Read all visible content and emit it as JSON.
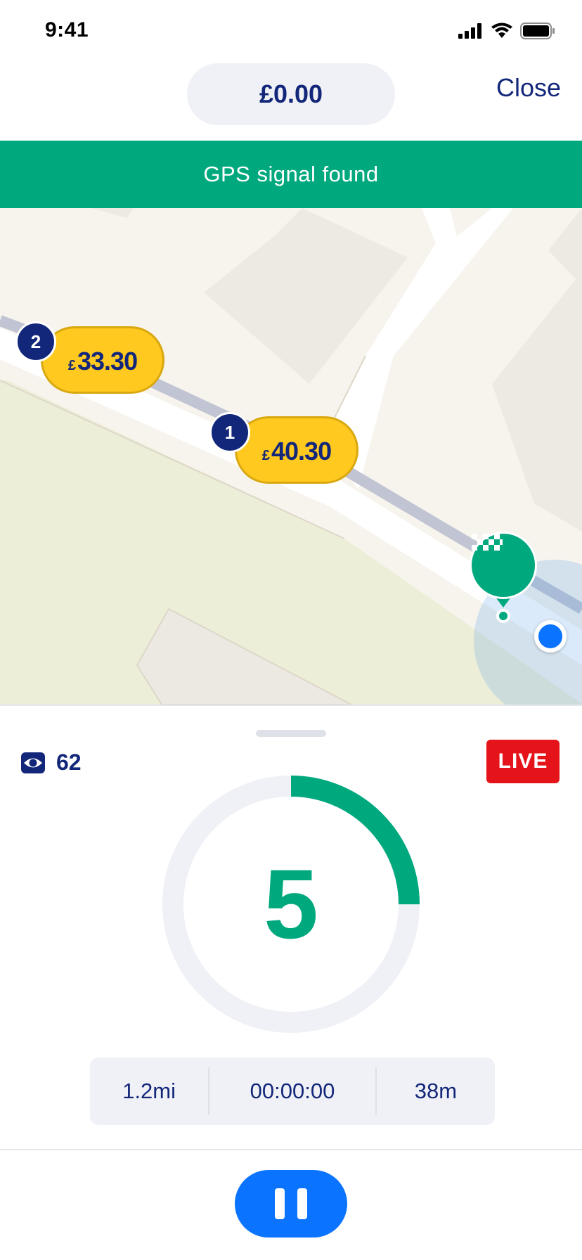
{
  "status_bar": {
    "time": "9:41",
    "icons": [
      "signal-icon",
      "wifi-icon",
      "battery-icon"
    ]
  },
  "header": {
    "fare": "£0.00",
    "close_label": "Close"
  },
  "banner": {
    "text": "GPS signal found",
    "color": "#00a87e"
  },
  "map": {
    "price_tags": [
      {
        "rank": "1",
        "currency": "£",
        "amount": "40.30"
      },
      {
        "rank": "2",
        "currency": "£",
        "amount": "33.30"
      }
    ],
    "taxi_icon": "taxi-checkered-icon",
    "location_icon": "current-location-icon"
  },
  "sheet": {
    "viewers_icon": "eye-icon",
    "viewers_count": "62",
    "live_label": "LIVE",
    "countdown": "5",
    "countdown_progress": 0.25,
    "stats": {
      "distance": "1.2mi",
      "duration": "00:00:00",
      "eta": "38m"
    },
    "pause_icon": "pause-icon"
  },
  "colors": {
    "brand_navy": "#13277a",
    "brand_green": "#00a87e",
    "price_yellow": "#ffc91f",
    "live_red": "#e5141a",
    "action_blue": "#0a73ff"
  }
}
